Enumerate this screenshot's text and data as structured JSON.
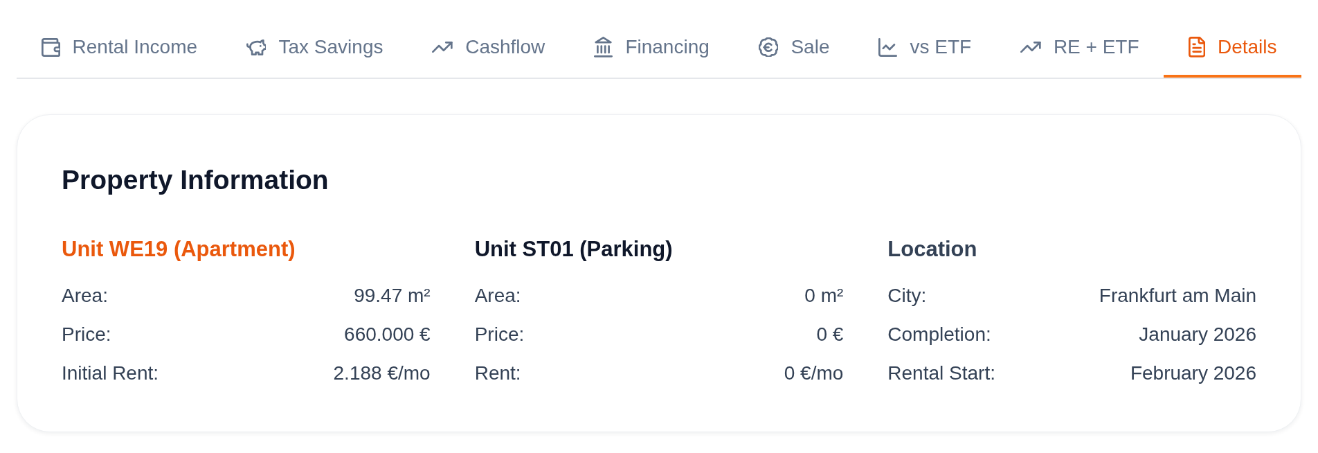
{
  "tabs": [
    {
      "label": "Rental Income",
      "selected": false
    },
    {
      "label": "Tax Savings",
      "selected": false
    },
    {
      "label": "Cashflow",
      "selected": false
    },
    {
      "label": "Financing",
      "selected": false
    },
    {
      "label": "Sale",
      "selected": false
    },
    {
      "label": "vs ETF",
      "selected": false
    },
    {
      "label": "RE + ETF",
      "selected": false
    },
    {
      "label": "Details",
      "selected": true
    }
  ],
  "property_info": {
    "title": "Property Information",
    "sections": [
      {
        "heading": "Unit WE19 (Apartment)",
        "color": "#ea580c",
        "rows": [
          {
            "label": "Area:",
            "value": "99.47 m²"
          },
          {
            "label": "Price:",
            "value": "660.000 €"
          },
          {
            "label": "Initial Rent:",
            "value": "2.188 €/mo"
          }
        ]
      },
      {
        "heading": "Unit ST01 (Parking)",
        "color": "#0f172a",
        "rows": [
          {
            "label": "Area:",
            "value": "0 m²"
          },
          {
            "label": "Price:",
            "value": "0 €"
          },
          {
            "label": "Rent:",
            "value": "0 €/mo"
          }
        ]
      },
      {
        "heading": "Location",
        "color": "#334155",
        "rows": [
          {
            "label": "City:",
            "value": "Frankfurt am Main"
          },
          {
            "label": "Completion:",
            "value": "January 2026"
          },
          {
            "label": "Rental Start:",
            "value": "February 2026"
          }
        ]
      }
    ]
  }
}
